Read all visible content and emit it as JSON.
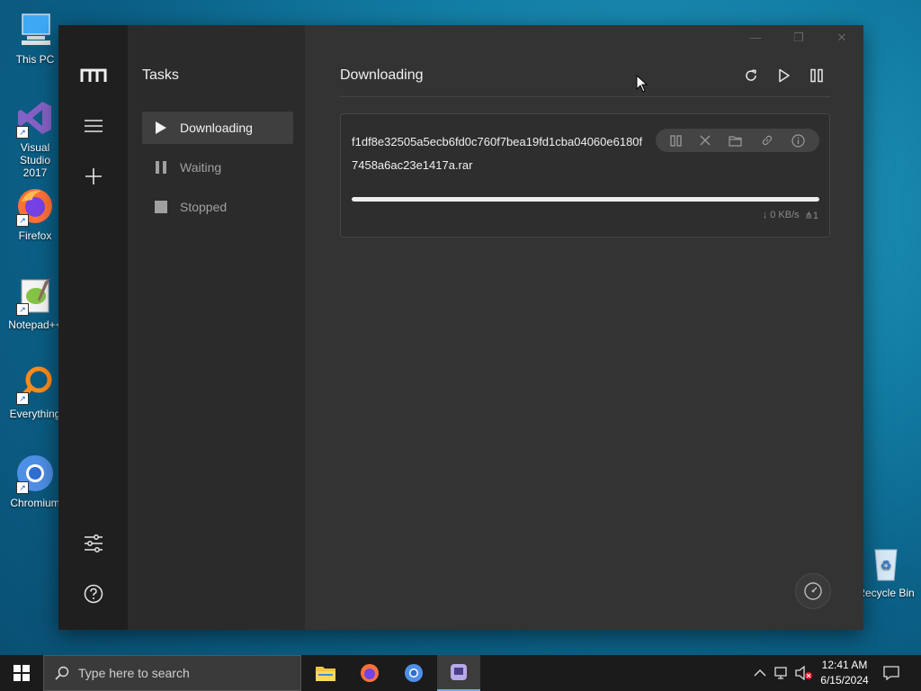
{
  "desktop": {
    "icons": [
      {
        "label": "This PC"
      },
      {
        "label": "Visual Studio 2017"
      },
      {
        "label": "Firefox"
      },
      {
        "label": "Notepad++"
      },
      {
        "label": "Everything"
      },
      {
        "label": "Chromium"
      },
      {
        "label": "Recycle Bin"
      }
    ]
  },
  "app": {
    "logo": "m",
    "rail": {
      "icons": [
        "menu-icon",
        "add-icon",
        "settings-sliders-icon",
        "help-icon"
      ]
    },
    "tasks_panel": {
      "title": "Tasks",
      "items": [
        {
          "label": "Downloading",
          "icon": "play-icon",
          "active": true
        },
        {
          "label": "Waiting",
          "icon": "pause-icon",
          "active": false
        },
        {
          "label": "Stopped",
          "icon": "stop-icon",
          "active": false
        }
      ]
    },
    "main": {
      "title": "Downloading",
      "toolbar_icons": [
        "refresh-icon",
        "resume-all-icon",
        "pause-all-icon"
      ],
      "tasks": [
        {
          "name": "f1df8e32505a5ecb6fd0c760f7bea19fd1cba04060e6180f7458a6ac23e1417a.rar",
          "progress_fraction": 1.0,
          "speed": "0 KB/s",
          "connections": "1"
        }
      ]
    }
  },
  "taskbar": {
    "search_placeholder": "Type here to search",
    "time": "12:41 AM",
    "date": "6/15/2024"
  }
}
